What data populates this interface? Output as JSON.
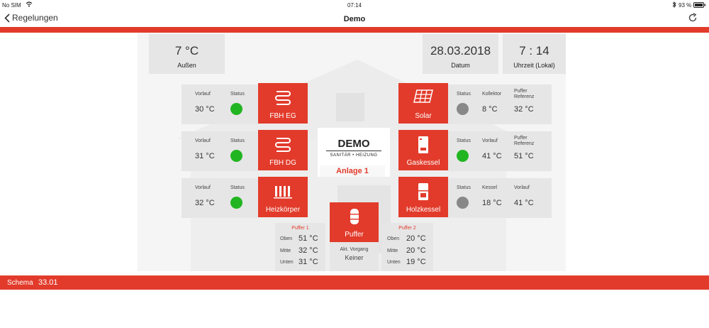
{
  "statusbar": {
    "carrier": "No SIM",
    "time": "07:14",
    "battery": "93 %"
  },
  "nav": {
    "back_label": "Regelungen",
    "title": "Demo"
  },
  "colors": {
    "accent": "#e23b2b",
    "ok": "#22b522",
    "off": "#888888"
  },
  "info": {
    "outside": {
      "value": "7 °C",
      "label": "Außen"
    },
    "date": {
      "value": "28.03.2018",
      "label": "Datum"
    },
    "time": {
      "value": "7 : 14",
      "label": "Uhrzeit (Lokal)"
    }
  },
  "circuits": [
    {
      "name": "FBH EG",
      "icon": "floor-heating-icon",
      "h1": "Vorlauf",
      "h2": "Status",
      "v1": "30 °C",
      "status": "on"
    },
    {
      "name": "FBH DG",
      "icon": "floor-heating-icon",
      "h1": "Vorlauf",
      "h2": "Status",
      "v1": "31 °C",
      "status": "on"
    },
    {
      "name": "Heizkörper",
      "icon": "radiator-icon",
      "h1": "Vorlauf",
      "h2": "Status",
      "v1": "32 °C",
      "status": "on"
    }
  ],
  "producers": [
    {
      "name": "Solar",
      "icon": "solar-panel-icon",
      "h1": "Status",
      "h2": "Kollektor",
      "h3": "Puffer Referenz",
      "v2": "8 °C",
      "v3": "32 °C",
      "status": "off"
    },
    {
      "name": "Gaskessel",
      "icon": "gas-boiler-icon",
      "h1": "Status",
      "h2": "Vorlauf",
      "h3": "Puffer Referenz",
      "v2": "41 °C",
      "v3": "51 °C",
      "status": "on"
    },
    {
      "name": "Holzkessel",
      "icon": "wood-boiler-icon",
      "h1": "Status",
      "h2": "Kessel",
      "h3": "Vorlauf",
      "v2": "18 °C",
      "v3": "41 °C",
      "status": "off"
    }
  ],
  "logo": {
    "brand": "DEMO",
    "tagline": "SANITÄR • HEIZUNG",
    "plant": "Anlage 1"
  },
  "puffer": {
    "name": "Puffer",
    "icon": "buffer-tank-icon",
    "action_label": "Akt. Vorgang",
    "action_value": "Keiner",
    "tank1": {
      "title": "Puffer 1",
      "rows": [
        {
          "label": "Oben",
          "value": "51 °C"
        },
        {
          "label": "Mitte",
          "value": "32 °C"
        },
        {
          "label": "Unten",
          "value": "31 °C"
        }
      ]
    },
    "tank2": {
      "title": "Puffer 2",
      "rows": [
        {
          "label": "Oben",
          "value": "20 °C"
        },
        {
          "label": "Mitte",
          "value": "20 °C"
        },
        {
          "label": "Unten",
          "value": "19 °C"
        }
      ]
    }
  },
  "footer": {
    "label": "Schema",
    "value": "33.01"
  }
}
